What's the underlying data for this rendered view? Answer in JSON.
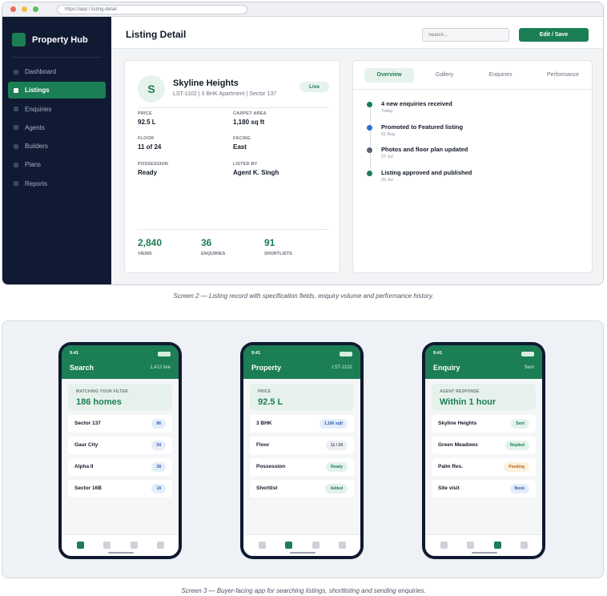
{
  "desktop": {
    "url": "https://app  /  listing-detail",
    "brand": "Property Hub",
    "nav": [
      "Dashboard",
      "Listings",
      "Enquiries",
      "Agents",
      "Builders",
      "Plans",
      "Reports"
    ],
    "active_nav": "Listings",
    "page_title": "Listing Detail",
    "search_placeholder": "Search...",
    "edit_button": "Edit  /  Save",
    "listing": {
      "avatar_letter": "S",
      "name": "Skyline Heights",
      "subtitle": "LST-1102  |  3 BHK Apartment  |  Sector 137",
      "status": "Live",
      "fields": [
        {
          "label": "PRICE",
          "value": "92.5 L"
        },
        {
          "label": "CARPET AREA",
          "value": "1,180 sq ft"
        },
        {
          "label": "FLOOR",
          "value": "11 of 24"
        },
        {
          "label": "FACING",
          "value": "East"
        },
        {
          "label": "POSSESSION",
          "value": "Ready"
        },
        {
          "label": "LISTED BY",
          "value": "Agent K. Singh"
        }
      ],
      "stats": [
        {
          "value": "2,840",
          "label": "VIEWS"
        },
        {
          "value": "36",
          "label": "ENQUIRIES"
        },
        {
          "value": "91",
          "label": "SHORTLISTS"
        }
      ]
    },
    "history": {
      "tabs": [
        "Overview",
        "Gallery",
        "Enquiries",
        "Performance"
      ],
      "active_tab": "Overview",
      "events": [
        {
          "title": "4 new enquiries received",
          "date": "Today",
          "color": "#1b7e55"
        },
        {
          "title": "Promoted to Featured listing",
          "date": "01 Aug",
          "color": "#2f6fcf"
        },
        {
          "title": "Photos and floor plan updated",
          "date": "27 Jul",
          "color": "#5b6270"
        },
        {
          "title": "Listing approved and published",
          "date": "20 Jul",
          "color": "#1b7e55"
        }
      ]
    }
  },
  "captions": {
    "screen2": "Screen 2 — Listing record with specification fields, enquiry volume and performance history.",
    "screen3": "Screen 3 — Buyer-facing app for searching listings, shortlisting and sending enquiries."
  },
  "phones": [
    {
      "time": "9:41",
      "title": "Search",
      "right": "1,412 live",
      "hero_label": "MATCHING YOUR FILTER",
      "hero_value": "186 homes",
      "rows": [
        {
          "label": "Sector 137",
          "badge": "86",
          "tone": "blue"
        },
        {
          "label": "Gaur City",
          "badge": "54",
          "tone": "blue"
        },
        {
          "label": "Alpha II",
          "badge": "28",
          "tone": "blue"
        },
        {
          "label": "Sector 16B",
          "badge": "18",
          "tone": "blue"
        }
      ],
      "active_tab": 0
    },
    {
      "time": "9:41",
      "title": "Property",
      "right": "LST-1102",
      "hero_label": "PRICE",
      "hero_value": "92.5 L",
      "rows": [
        {
          "label": "3 BHK",
          "badge": "1,180 sqft",
          "tone": "blue"
        },
        {
          "label": "Floor",
          "badge": "11 / 24",
          "tone": "gray"
        },
        {
          "label": "Possession",
          "badge": "Ready",
          "tone": "green"
        },
        {
          "label": "Shortlist",
          "badge": "Added",
          "tone": "green"
        }
      ],
      "active_tab": 1
    },
    {
      "time": "9:41",
      "title": "Enquiry",
      "right": "Sent",
      "hero_label": "AGENT RESPONSE",
      "hero_value": "Within 1 hour",
      "rows": [
        {
          "label": "Skyline Heights",
          "badge": "Sent",
          "tone": "green"
        },
        {
          "label": "Green Meadows",
          "badge": "Replied",
          "tone": "green"
        },
        {
          "label": "Palm Res.",
          "badge": "Pending",
          "tone": "amber"
        },
        {
          "label": "Site visit",
          "badge": "Book",
          "tone": "blue"
        }
      ],
      "active_tab": 2
    }
  ]
}
